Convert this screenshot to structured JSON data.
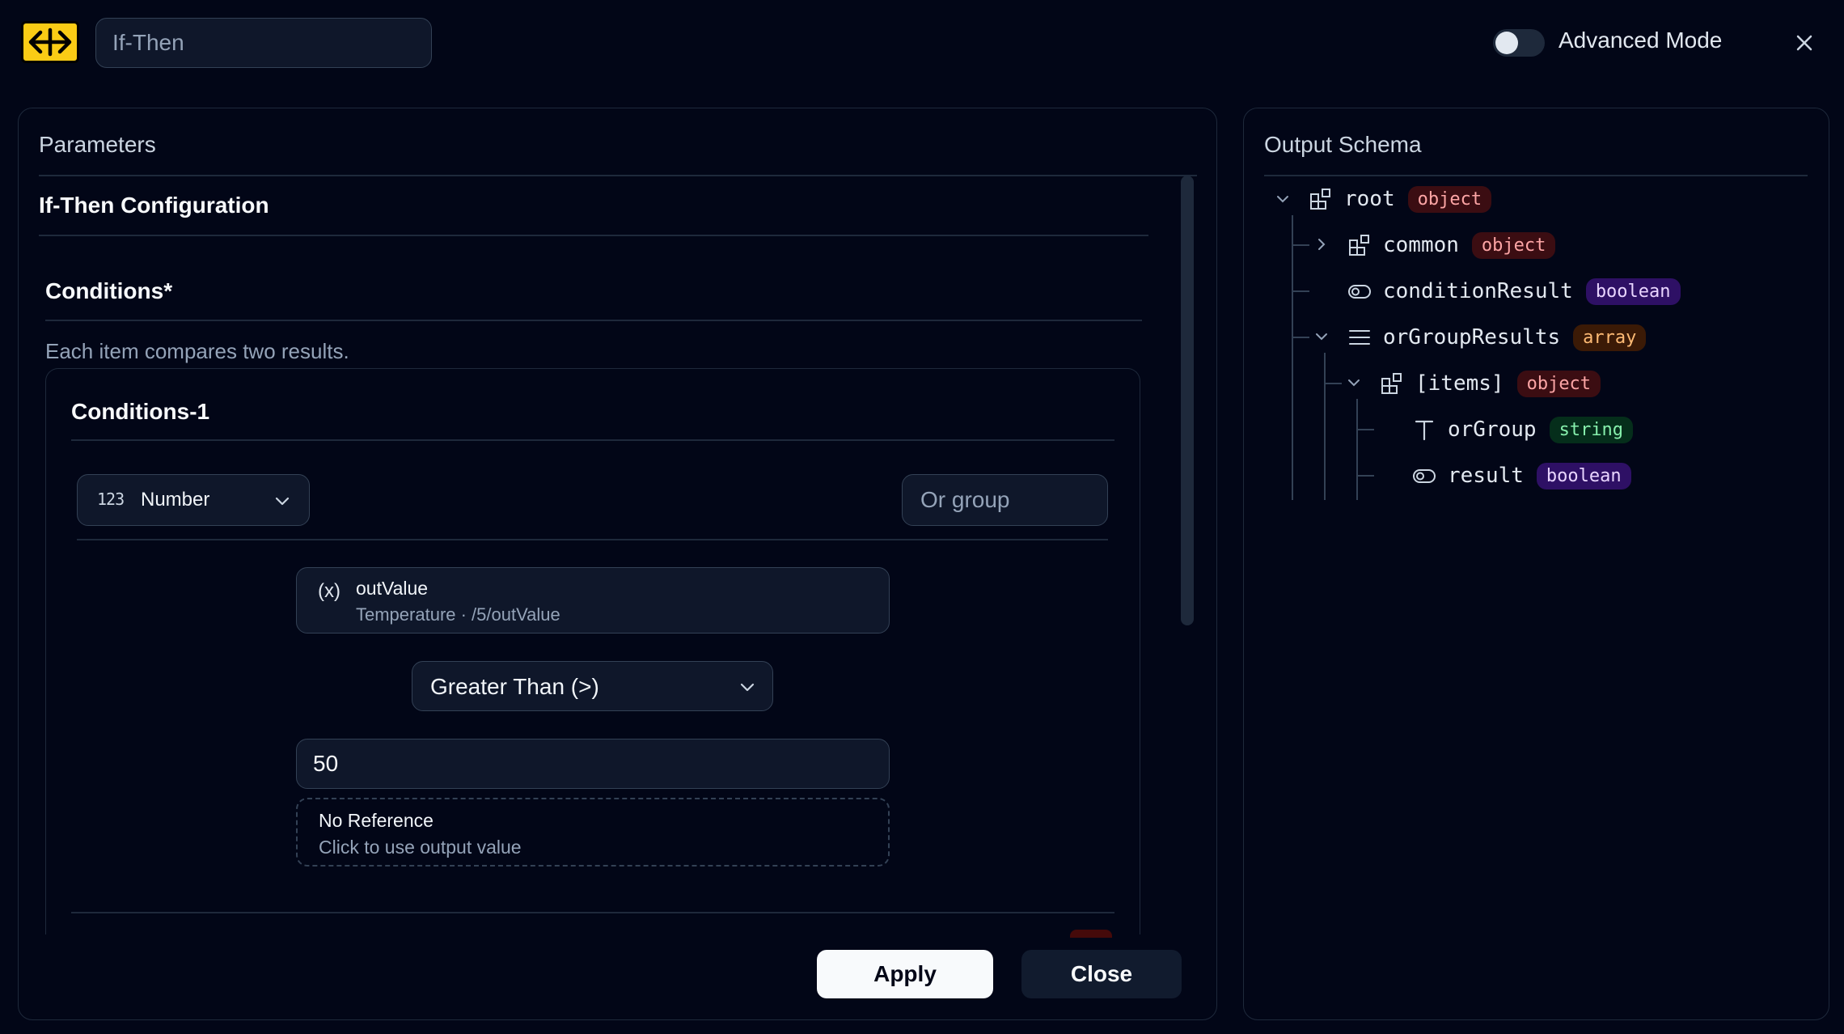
{
  "header": {
    "title_value": "If-Then",
    "advanced_mode_label": "Advanced Mode",
    "advanced_mode_on": false
  },
  "parameters": {
    "panel_title": "Parameters",
    "section_title": "If-Then Configuration",
    "conditions_label": "Conditions*",
    "conditions_help": "Each item compares two results.",
    "condition_1": {
      "title": "Conditions-1",
      "type_select": {
        "icon_text": "123",
        "value": "Number"
      },
      "or_group_placeholder": "Or group",
      "left_operand": {
        "icon_text": "(x)",
        "name": "outValue",
        "path": "Temperature · /5/outValue"
      },
      "operator": "Greater Than (>)",
      "right_value": "50",
      "reference": {
        "title": "No Reference",
        "hint": "Click to use output value"
      }
    }
  },
  "actions": {
    "apply_label": "Apply",
    "close_label": "Close"
  },
  "output_schema": {
    "panel_title": "Output Schema",
    "nodes": [
      {
        "name": "root",
        "type": "object"
      },
      {
        "name": "common",
        "type": "object"
      },
      {
        "name": "conditionResult",
        "type": "boolean"
      },
      {
        "name": "orGroupResults",
        "type": "array"
      },
      {
        "name": "[items]",
        "type": "object"
      },
      {
        "name": "orGroup",
        "type": "string"
      },
      {
        "name": "result",
        "type": "boolean"
      }
    ]
  },
  "colors": {
    "background": "#020617",
    "logo": "#facc15",
    "object_badge": "#fca5a5",
    "boolean_badge": "#e9d5ff",
    "array_badge": "#fdba74",
    "string_badge": "#86efac"
  }
}
